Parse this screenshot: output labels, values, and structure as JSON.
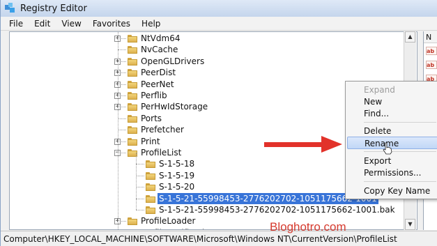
{
  "window": {
    "title": "Registry Editor"
  },
  "menu": [
    "File",
    "Edit",
    "View",
    "Favorites",
    "Help"
  ],
  "tree": {
    "items": [
      {
        "label": "NtVdm64",
        "expander": "+"
      },
      {
        "label": "NvCache",
        "expander": ""
      },
      {
        "label": "OpenGLDrivers",
        "expander": "+"
      },
      {
        "label": "PeerDist",
        "expander": "+"
      },
      {
        "label": "PeerNet",
        "expander": "+"
      },
      {
        "label": "Perflib",
        "expander": "+"
      },
      {
        "label": "PerHwIdStorage",
        "expander": "+"
      },
      {
        "label": "Ports",
        "expander": ""
      },
      {
        "label": "Prefetcher",
        "expander": ""
      },
      {
        "label": "Print",
        "expander": "+"
      },
      {
        "label": "ProfileList",
        "expander": "−"
      },
      {
        "label": "S-1-5-18",
        "expander": ""
      },
      {
        "label": "S-1-5-19",
        "expander": ""
      },
      {
        "label": "S-1-5-20",
        "expander": ""
      },
      {
        "label": "S-1-5-21-55998453-2776202702-1051175662-1001",
        "expander": "",
        "selected": true
      },
      {
        "label": "S-1-5-21-55998453-2776202702-1051175662-1001.bak",
        "expander": ""
      },
      {
        "label": "ProfileLoader",
        "expander": "+"
      },
      {
        "label": "ProfileNotification",
        "expander": "+"
      }
    ]
  },
  "right_pane": {
    "header": "N",
    "values": [
      "ab",
      "ab",
      "ab"
    ]
  },
  "context_menu": {
    "items": [
      {
        "label": "Expand",
        "disabled": true
      },
      {
        "label": "New"
      },
      {
        "label": "Find..."
      },
      {
        "label": "Delete"
      },
      {
        "label": "Rename",
        "hover": true
      },
      {
        "label": "Export"
      },
      {
        "label": "Permissions..."
      },
      {
        "label": "Copy Key Name"
      }
    ]
  },
  "statusbar": {
    "path": "Computer\\HKEY_LOCAL_MACHINE\\SOFTWARE\\Microsoft\\Windows NT\\CurrentVersion\\ProfileList"
  },
  "watermark": "Bloghotro.com",
  "colors": {
    "selection": "#3874d8",
    "arrow": "#e2322a",
    "watermark": "#d63a2e"
  }
}
